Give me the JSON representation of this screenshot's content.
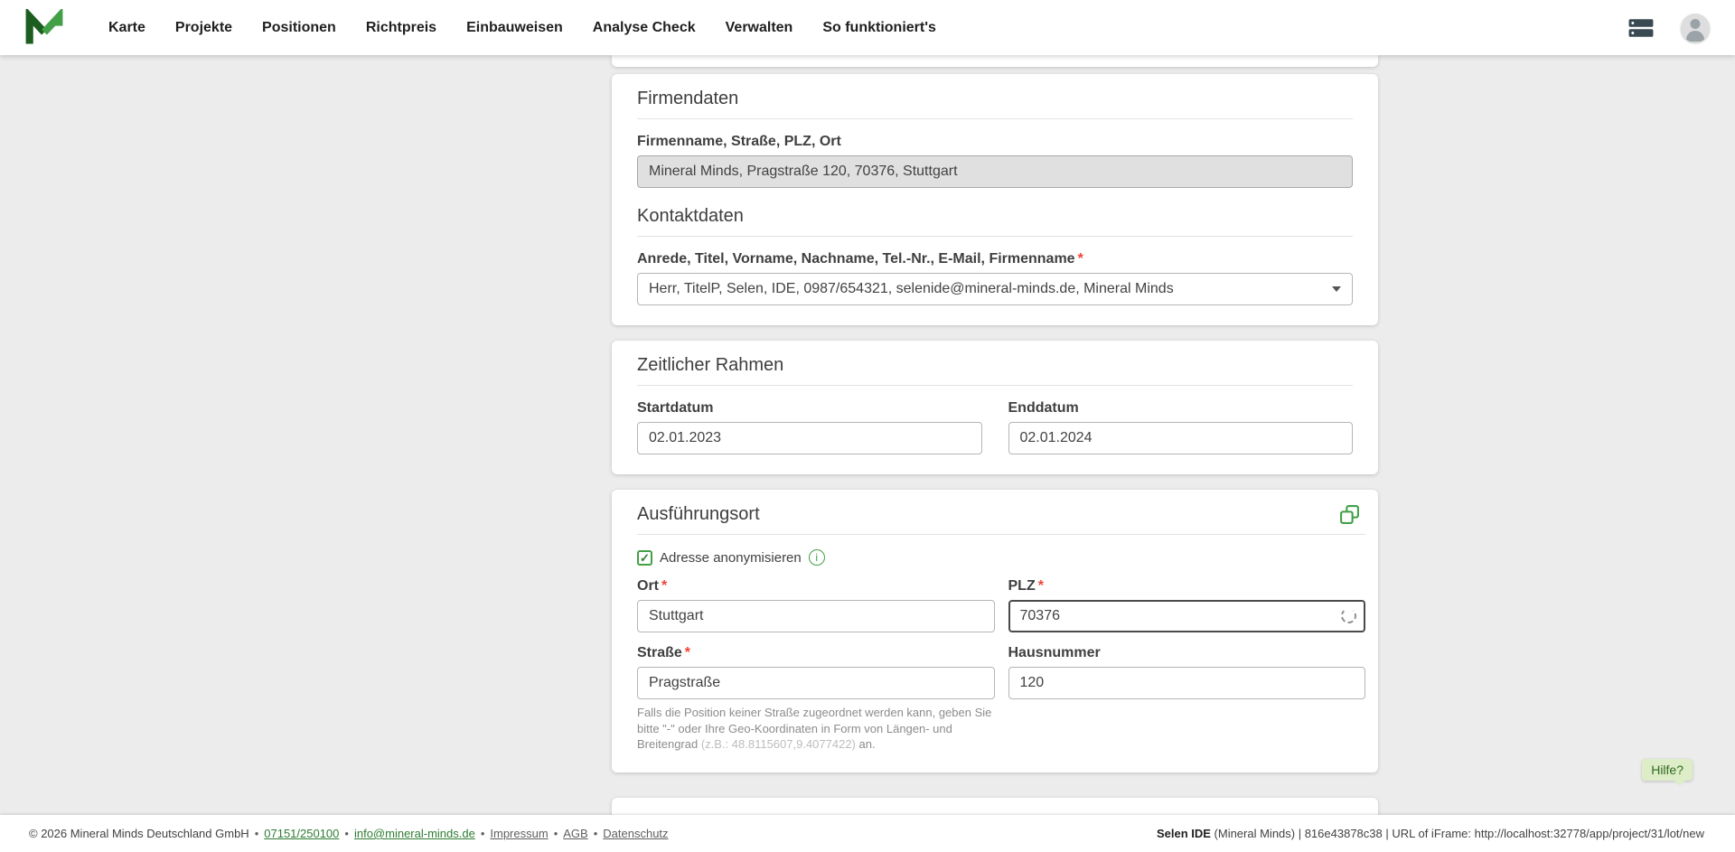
{
  "ui": {
    "required_marker": "*",
    "bullet": "•"
  },
  "navbar": {
    "items": [
      "Karte",
      "Projekte",
      "Positionen",
      "Richtpreis",
      "Einbauweisen",
      "Analyse Check",
      "Verwalten",
      "So funktioniert's"
    ]
  },
  "firmendaten": {
    "title": "Firmendaten",
    "company_label": "Firmenname, Straße, PLZ, Ort",
    "company_value": "Mineral Minds, Pragstraße 120, 70376, Stuttgart",
    "kontakt_title": "Kontaktdaten",
    "kontakt_label": "Anrede, Titel, Vorname, Nachname, Tel.-Nr., E-Mail, Firmenname",
    "kontakt_value": "Herr, TitelP, Selen, IDE, 0987/654321, selenide@mineral-minds.de, Mineral Minds"
  },
  "zeitraum": {
    "title": "Zeitlicher Rahmen",
    "start_label": "Startdatum",
    "start_value": "02.01.2023",
    "end_label": "Enddatum",
    "end_value": "02.01.2024"
  },
  "ausfuehrungsort": {
    "title": "Ausführungsort",
    "anonymize_label": "Adresse anonymisieren",
    "ort_label": "Ort",
    "ort_value": "Stuttgart",
    "plz_label": "PLZ",
    "plz_value": "70376",
    "strasse_label": "Straße",
    "strasse_value": "Pragstraße",
    "hausnummer_label": "Hausnummer",
    "hausnummer_value": "120",
    "help_text_1": "Falls die Position keiner Straße zugeordnet werden kann, geben Sie bitte \"-\" oder Ihre Geo-Koordinaten in Form von Längen- und Breitengrad ",
    "help_text_coords": "(z.B.: 48.8115607,9.4077422)",
    "help_text_2": " an."
  },
  "help_button": {
    "label": "Hilfe?"
  },
  "footer": {
    "copyright": "© 2026 Mineral Minds Deutschland GmbH",
    "phone": "07151/250100",
    "email": "info@mineral-minds.de",
    "links": [
      "Impressum",
      "AGB",
      "Datenschutz"
    ],
    "right_bold": "Selen IDE",
    "right_rest": " (Mineral Minds) | 816e43878c38 | URL of iFrame: http://localhost:32778/app/project/31/lot/new"
  }
}
